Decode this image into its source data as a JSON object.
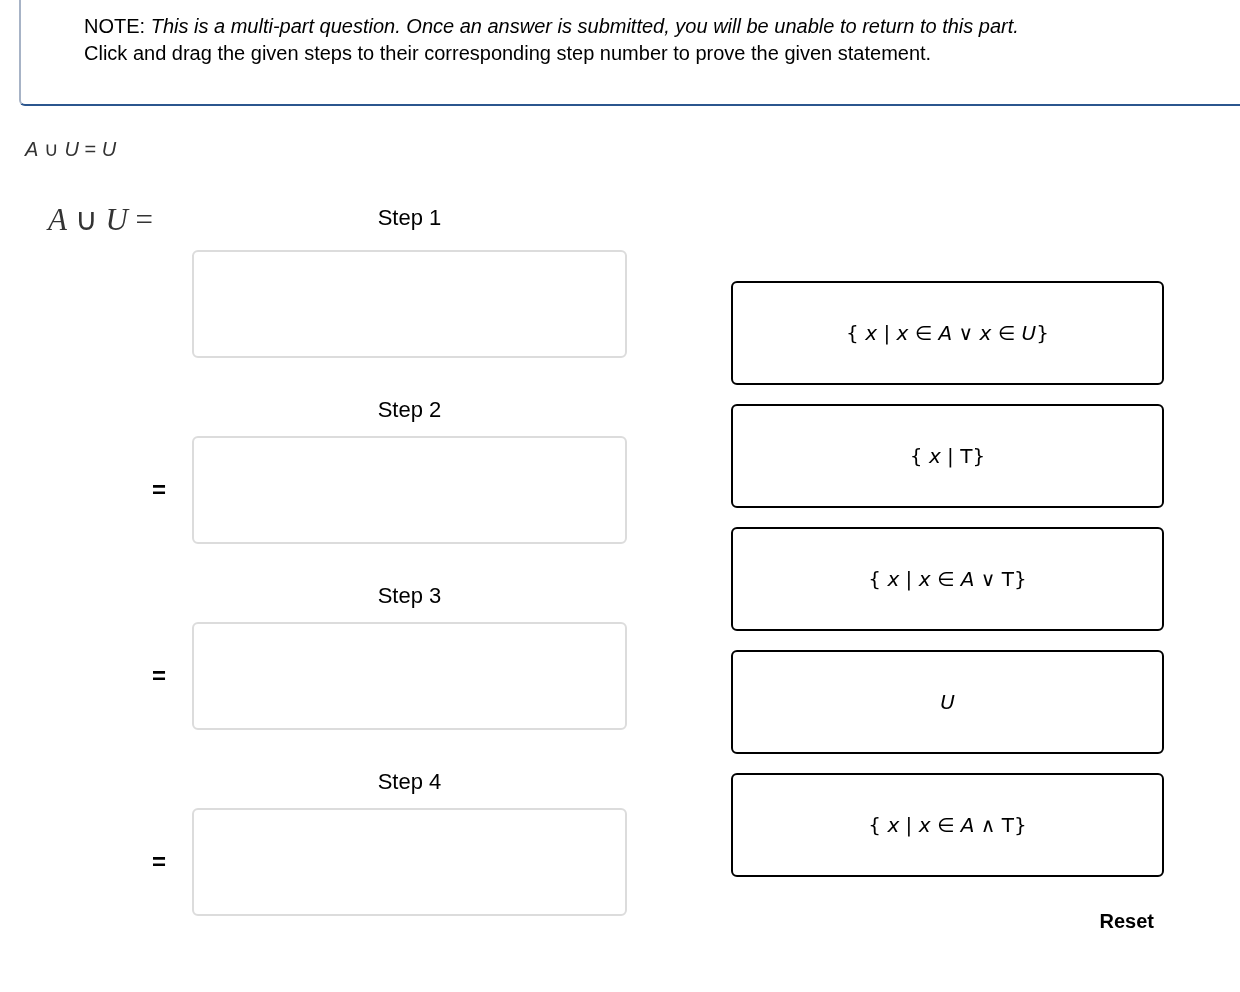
{
  "note": {
    "lines": [
      "NOTE: *This is a multi-part question. Once an answer is submitted, you will be unable to return to this part.*",
      "Click and drag the given steps to their corresponding step number to prove the given statement."
    ]
  },
  "statement": "*A* ∪ *U* = *U*",
  "proof": {
    "lhs": "*A* ∪ *U* =",
    "steps": [
      {
        "label": "Step 1"
      },
      {
        "label": "Step 2",
        "relation": "="
      },
      {
        "label": "Step 3",
        "relation": "="
      },
      {
        "label": "Step 4",
        "relation": "="
      }
    ]
  },
  "answer_tiles": [
    "{ *x* | *x* ∈ *A* ∨ *x* ∈ *U*}",
    "{ *x* | T}",
    "{ *x* | *x* ∈ *A* ∨ T}",
    "*U*",
    "{ *x* | *x* ∈ *A* ∧ T}"
  ],
  "buttons": [
    "Reset"
  ]
}
